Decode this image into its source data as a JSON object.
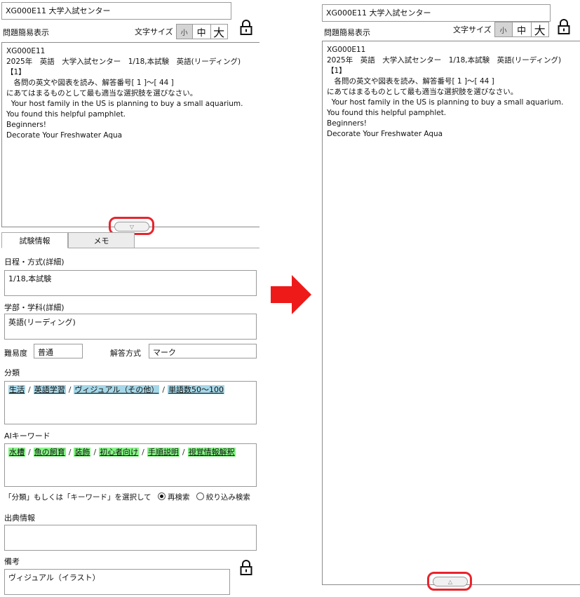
{
  "left": {
    "header_title": "XG000E11 大学入試センター",
    "simple_view_label": "問題簡易表示",
    "font_size_label": "文字サイズ",
    "size_buttons": [
      "小",
      "中",
      "大"
    ],
    "problem_lines": [
      "XG000E11",
      "2025年　英語　大学入試センター　1/18,本試験　英語(リーディング)",
      "",
      "【1】",
      "",
      "　各問の英文や図表を読み、解答番号[ 1 ]〜[ 44 ]",
      "にあてはまるものとして最も適当な選択肢を選びなさい。",
      "",
      "  Your host family in the US is planning to buy a small aquarium. You found this helpful pamphlet.",
      "",
      "Beginners!",
      "Decorate Your Freshwater Aqua"
    ],
    "expand_glyph": "▽",
    "tabs": [
      "試験情報",
      "メモ"
    ],
    "schedule_label": "日程・方式(詳細)",
    "schedule_value": "1/18,本試験",
    "dept_label": "学部・学科(詳細)",
    "dept_value": "英語(リーディング)",
    "difficulty_label": "難易度",
    "difficulty_value": "普通",
    "answer_type_label": "解答方式",
    "answer_type_value": "マーク",
    "category_label": "分類",
    "categories": [
      "生活",
      "英語学習",
      "ヴィジュアル（その他）",
      "単語数50〜100"
    ],
    "ai_keyword_label": "AIキーワード",
    "ai_keywords": [
      "水槽",
      "魚の飼育",
      "装飾",
      "初心者向け",
      "手順説明",
      "視覚情報解釈"
    ],
    "search_instruction": "「分類」もしくは「キーワード」を選択して",
    "search_options": [
      "再検索",
      "絞り込み検索"
    ],
    "source_label": "出典情報",
    "source_value": "",
    "remarks_label": "備考",
    "remarks_value": "ヴィジュアル（イラスト）"
  },
  "right": {
    "header_title": "XG000E11 大学入試センター",
    "simple_view_label": "問題簡易表示",
    "font_size_label": "文字サイズ",
    "size_buttons": [
      "小",
      "中",
      "大"
    ],
    "problem_lines": [
      "XG000E11",
      "2025年　英語　大学入試センター　1/18,本試験　英語(リーディング)",
      "",
      "【1】",
      "",
      "　各問の英文や図表を読み、解答番号[ 1 ]〜[ 44 ]",
      "にあてはまるものとして最も適当な選択肢を選びなさい。",
      "",
      "  Your host family in the US is planning to buy a small aquarium. You found this helpful pamphlet.",
      "",
      "Beginners!",
      "Decorate Your Freshwater Aqua"
    ],
    "collapse_glyph": "△"
  },
  "colors": {
    "highlight_red": "#e8242c",
    "category_blue": "#a5d7e8",
    "keyword_green": "#86f586",
    "arrow_red": "#ee1a1a"
  }
}
